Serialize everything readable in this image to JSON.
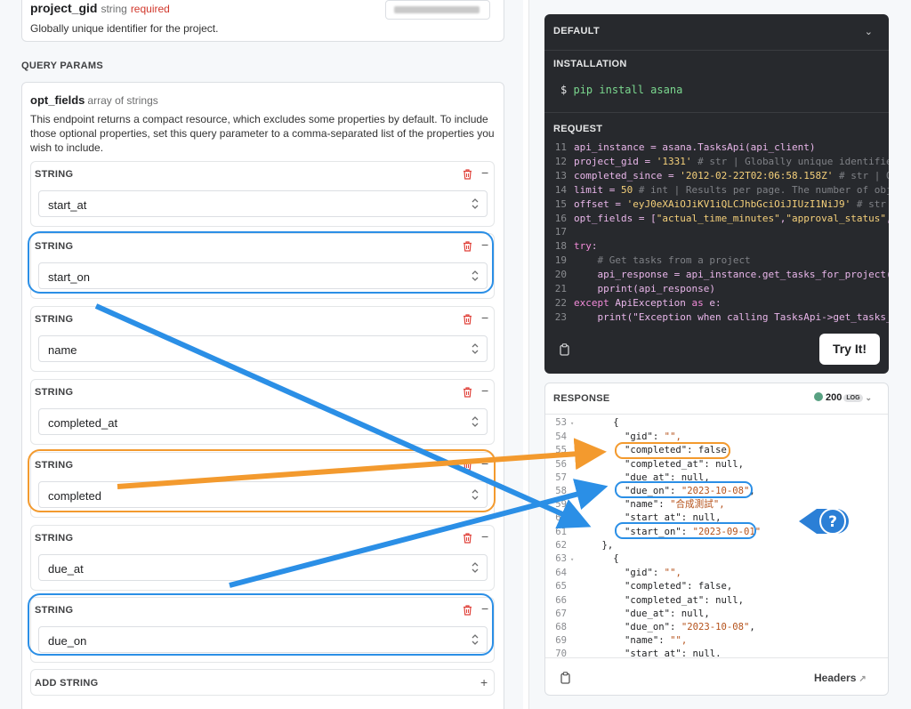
{
  "left": {
    "path_param": {
      "name": "project_gid",
      "type": "string",
      "required": "required",
      "description": "Globally unique identifier for the project."
    },
    "query_params_title": "QUERY PARAMS",
    "opt_fields": {
      "name": "opt_fields",
      "type": "array of strings",
      "description": "This endpoint returns a compact resource, which excludes some properties by default. To include those optional properties, set this query parameter to a comma-separated list of the properties you wish to include.",
      "items": [
        {
          "label": "STRING",
          "value": "start_at"
        },
        {
          "label": "STRING",
          "value": "start_on"
        },
        {
          "label": "STRING",
          "value": "name"
        },
        {
          "label": "STRING",
          "value": "completed_at"
        },
        {
          "label": "STRING",
          "value": "completed"
        },
        {
          "label": "STRING",
          "value": "due_at"
        },
        {
          "label": "STRING",
          "value": "due_on"
        }
      ],
      "add_label": "ADD STRING"
    }
  },
  "request": {
    "default_label": "DEFAULT",
    "installation_label": "INSTALLATION",
    "install_prompt": "$",
    "install_command": "pip install asana",
    "request_label": "REQUEST",
    "code_lines": [
      {
        "n": "11",
        "text": "api_instance = asana.TasksApi(api_client)"
      },
      {
        "n": "12",
        "text": "project_gid = '1331' # str | Globally unique identifie"
      },
      {
        "n": "13",
        "text": "completed_since = '2012-02-22T02:06:58.158Z' # str | O"
      },
      {
        "n": "14",
        "text": "limit = 50 # int | Results per page. The number of obj"
      },
      {
        "n": "15",
        "text": "offset = 'eyJ0eXAiOJiKV1iQLCJhbGciOiJIUzI1NiJ9' # str"
      },
      {
        "n": "16",
        "text": "opt_fields = [\"actual_time_minutes\",\"approval_status\","
      },
      {
        "n": "17",
        "text": ""
      },
      {
        "n": "18",
        "text": "try:"
      },
      {
        "n": "19",
        "text": "    # Get tasks from a project"
      },
      {
        "n": "20",
        "text": "    api_response = api_instance.get_tasks_for_project(p"
      },
      {
        "n": "21",
        "text": "    pprint(api_response)"
      },
      {
        "n": "22",
        "text": "except ApiException as e:"
      },
      {
        "n": "23",
        "text": "    print(\"Exception when calling TasksApi->get_tasks_"
      }
    ],
    "try_it_label": "Try It!"
  },
  "response": {
    "label": "RESPONSE",
    "status_code": "200",
    "log_badge": "LOG",
    "headers_label": "Headers",
    "lines": [
      {
        "n": "53",
        "text": "{"
      },
      {
        "n": "54",
        "text": "\"gid\": \"\","
      },
      {
        "n": "55",
        "text": "\"completed\": false,"
      },
      {
        "n": "56",
        "text": "\"completed_at\": null,"
      },
      {
        "n": "57",
        "text": "\"due_at\": null,"
      },
      {
        "n": "58",
        "text": "\"due_on\": \"2023-10-08\","
      },
      {
        "n": "59",
        "text": "\"name\": \"合成測試\","
      },
      {
        "n": "60",
        "text": "\"start_at\": null,"
      },
      {
        "n": "61",
        "text": "\"start_on\": \"2023-09-01\""
      },
      {
        "n": "62",
        "text": "},"
      },
      {
        "n": "63",
        "text": "{"
      },
      {
        "n": "64",
        "text": "\"gid\": \"\","
      },
      {
        "n": "65",
        "text": "\"completed\": false,"
      },
      {
        "n": "66",
        "text": "\"completed_at\": null,"
      },
      {
        "n": "67",
        "text": "\"due_at\": null,"
      },
      {
        "n": "68",
        "text": "\"due_on\": \"2023-10-08\","
      },
      {
        "n": "69",
        "text": "\"name\": \"\","
      },
      {
        "n": "70",
        "text": "\"start_at\": null,"
      }
    ]
  },
  "help_icon": "question-icon",
  "colors": {
    "blue_highlight": "#2b8fe6",
    "orange_highlight": "#f39a2e",
    "code_bg": "#27292d",
    "status_green": "#58a182"
  }
}
